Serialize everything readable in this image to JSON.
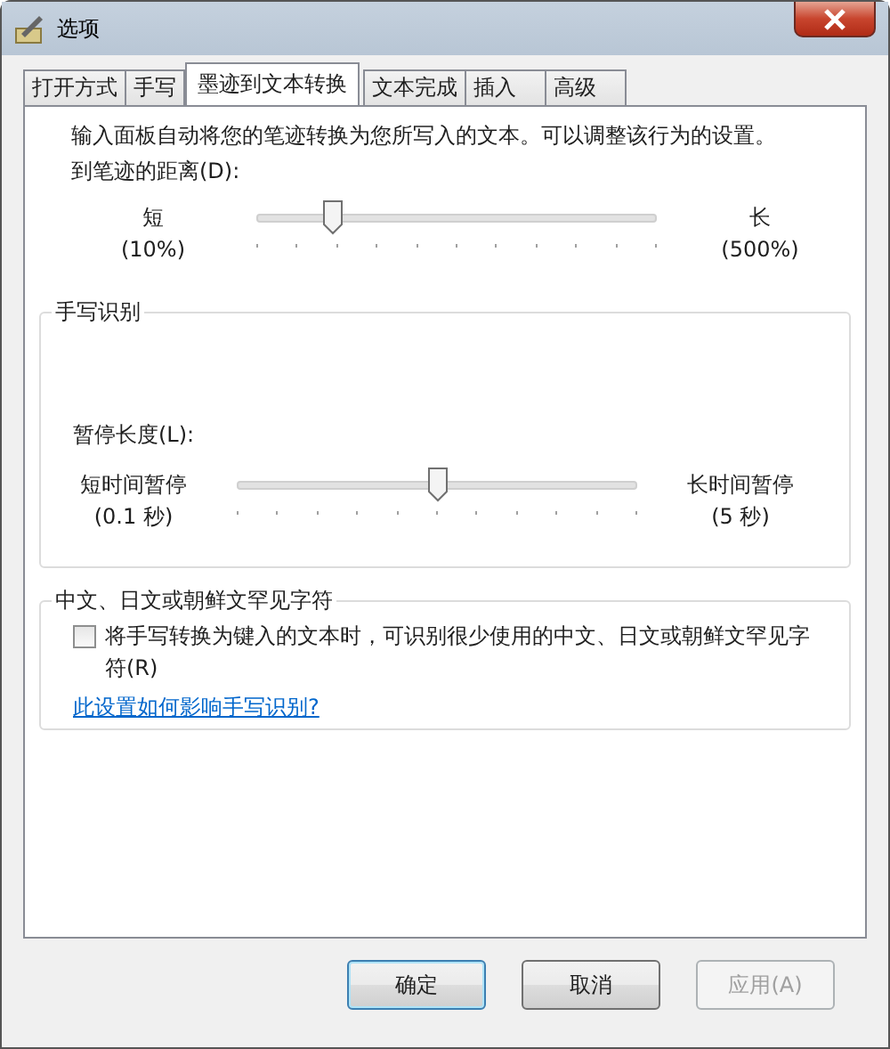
{
  "window": {
    "title": "选项"
  },
  "tabs": [
    {
      "label": "打开方式",
      "selected": false
    },
    {
      "label": "手写",
      "selected": false
    },
    {
      "label": "墨迹到文本转换",
      "selected": true
    },
    {
      "label": "文本完成",
      "selected": false
    },
    {
      "label": "插入",
      "selected": false
    },
    {
      "label": "高级",
      "selected": false
    }
  ],
  "description": "输入面板自动将您的笔迹转换为您所写入的文本。可以调整该行为的设置。",
  "distance": {
    "label": "到笔迹的距离(D):",
    "min_label": "短",
    "min_value": "(10%)",
    "max_label": "长",
    "max_value": "(500%)",
    "level": 0.19
  },
  "recognition": {
    "title": "手写识别",
    "pause": {
      "label": "暂停长度(L):",
      "min_label": "短时间暂停",
      "min_value": "(0.1 秒)",
      "max_label": "长时间暂停",
      "max_value": "(5 秒)",
      "level": 0.5
    }
  },
  "rare_characters": {
    "title": "中文、日文或朝鲜文罕见字符",
    "checkbox": {
      "label": "将手写转换为键入的文本时，可识别很少使用的中文、日文或朝鲜文罕见字符(R)",
      "checked": false
    },
    "link": "此设置如何影响手写识别?"
  },
  "buttons": [
    {
      "label": "确定",
      "kind": "default",
      "disabled": false
    },
    {
      "label": "取消",
      "kind": "normal",
      "disabled": false
    },
    {
      "label": "应用(A)",
      "kind": "normal",
      "disabled": true
    }
  ]
}
